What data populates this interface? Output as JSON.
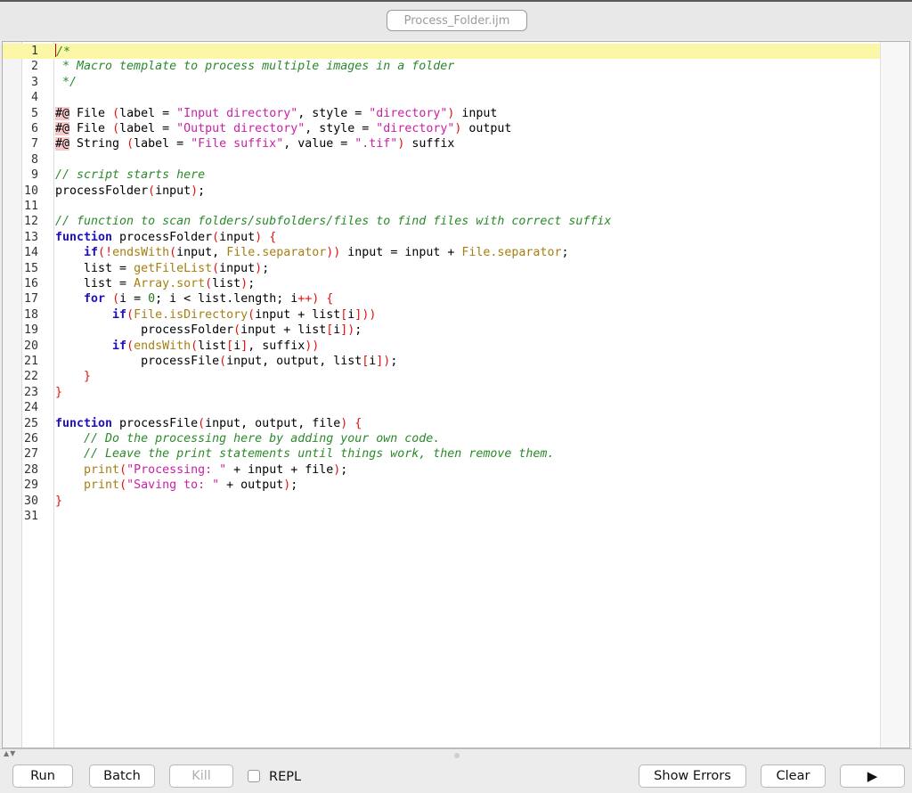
{
  "window": {
    "title": "Process_Folder.ijm"
  },
  "editor": {
    "active_line": 1,
    "line_numbers": [
      "1",
      "2",
      "3",
      "4",
      "5",
      "6",
      "7",
      "8",
      "9",
      "10",
      "11",
      "12",
      "13",
      "14",
      "15",
      "16",
      "17",
      "18",
      "19",
      "20",
      "21",
      "22",
      "23",
      "24",
      "25",
      "26",
      "27",
      "28",
      "29",
      "30",
      "31"
    ],
    "code": [
      [
        "/*"
      ],
      [
        " * Macro template to process multiple images in a folder"
      ],
      [
        " */"
      ],
      [],
      [
        "#@",
        " File ",
        "(",
        "label = ",
        "\"Input directory\"",
        ", style = ",
        "\"directory\"",
        ")",
        " input"
      ],
      [
        "#@",
        " File ",
        "(",
        "label = ",
        "\"Output directory\"",
        ", style = ",
        "\"directory\"",
        ")",
        " output"
      ],
      [
        "#@",
        " String ",
        "(",
        "label = ",
        "\"File suffix\"",
        ", value = ",
        "\".tif\"",
        ")",
        " suffix"
      ],
      [],
      [
        "// script starts here"
      ],
      [
        "processFolder",
        "(",
        "input",
        ")",
        ";"
      ],
      [],
      [
        "// function to scan folders/subfolders/files to find files with correct suffix"
      ],
      [
        "function",
        " processFolder",
        "(",
        "input",
        ")",
        " ",
        "{"
      ],
      [
        "    ",
        "if",
        "(",
        "!",
        "endsWith",
        "(",
        "input, ",
        "File.separator",
        "))",
        " input = input + ",
        "File.separator",
        ";"
      ],
      [
        "    list = ",
        "getFileList",
        "(",
        "input",
        ")",
        ";"
      ],
      [
        "    list = ",
        "Array.sort",
        "(",
        "list",
        ")",
        ";"
      ],
      [
        "    ",
        "for",
        " ",
        "(",
        "i = ",
        "0",
        "; i < list.length; i",
        "++",
        ") ",
        "{"
      ],
      [
        "        ",
        "if",
        "(",
        "File.isDirectory",
        "(",
        "input + list",
        "[",
        "i",
        "]",
        "))"
      ],
      [
        "            processFolder",
        "(",
        "input + list",
        "[",
        "i",
        "]",
        ")",
        ";"
      ],
      [
        "        ",
        "if",
        "(",
        "endsWith",
        "(",
        "list",
        "[",
        "i",
        "]",
        ", suffix",
        "))"
      ],
      [
        "            processFile",
        "(",
        "input, output, list",
        "[",
        "i",
        "]",
        ")",
        ";"
      ],
      [
        "    ",
        "}"
      ],
      [
        "}"
      ],
      [],
      [
        "function",
        " processFile",
        "(",
        "input, output, file",
        ")",
        " ",
        "{"
      ],
      [
        "    ",
        "// Do the processing here by adding your own code."
      ],
      [
        "    ",
        "// Leave the print statements until things work, then remove them."
      ],
      [
        "    ",
        "print",
        "(",
        "\"Processing: \"",
        " + input + file",
        ")",
        ";"
      ],
      [
        "    ",
        "print",
        "(",
        "\"Saving to: \"",
        " + output",
        ")",
        ";"
      ],
      [
        "}"
      ],
      []
    ]
  },
  "toolbar": {
    "run": "Run",
    "batch": "Batch",
    "kill": "Kill",
    "repl": "REPL",
    "repl_checked": false,
    "show_errors": "Show Errors",
    "clear": "Clear",
    "play": "▶"
  }
}
